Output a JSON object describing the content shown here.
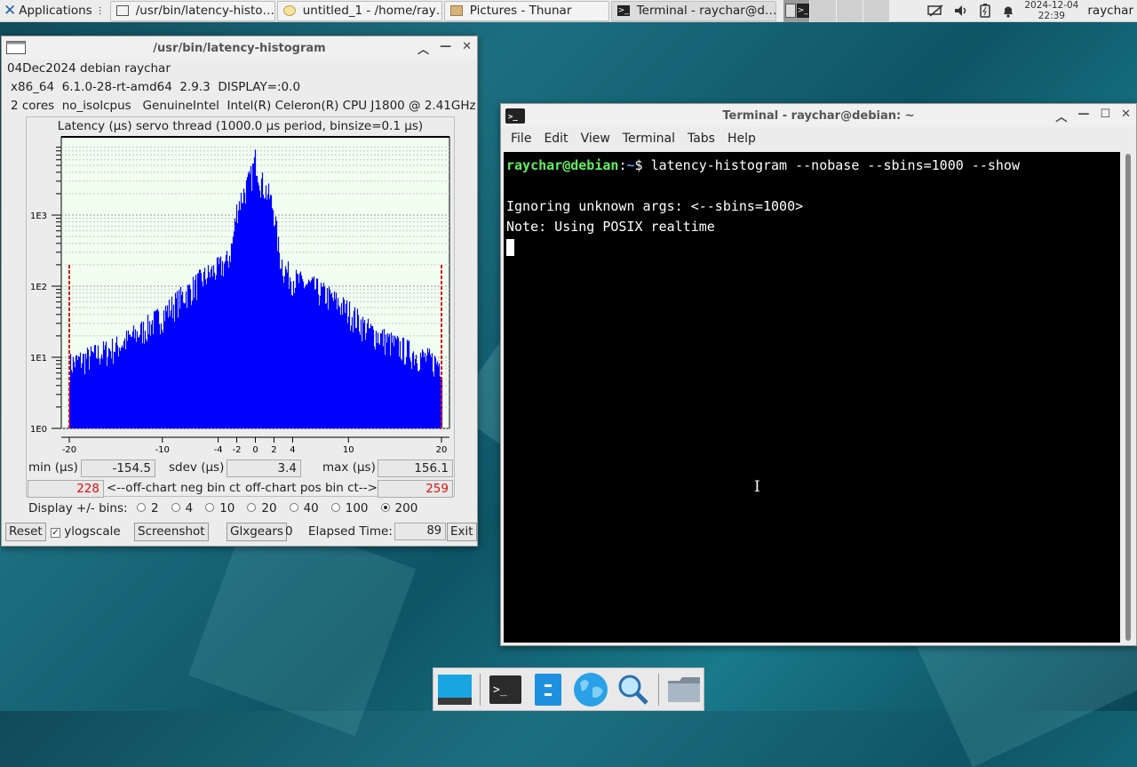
{
  "panel": {
    "applications_label": "Applications",
    "tasks": [
      {
        "label": "/usr/bin/latency-histo…",
        "icon": "window-icon"
      },
      {
        "label": "untitled_1 - /home/ray…",
        "icon": "text-editor-icon"
      },
      {
        "label": "Pictures - Thunar",
        "icon": "folder-icon"
      },
      {
        "label": "Terminal - raychar@d…",
        "icon": "terminal-icon"
      }
    ],
    "clock_date": "2024-12-04",
    "clock_time": "22:39",
    "user": "raychar"
  },
  "histogram_window": {
    "title": "/usr/bin/latency-histogram",
    "line1": "04Dec2024 debian raychar",
    "line2": "x86_64  6.1.0-28-rt-amd64  2.9.3  DISPLAY=:0.0",
    "line3": "2 cores  no_isolcpus   GenuineIntel  Intel(R) Celeron(R) CPU J1800 @ 2.41GHz",
    "min_label": "min (µs)",
    "min_value": "-154.5",
    "sdev_label": "sdev (µs)",
    "sdev_value": "3.4",
    "max_label": "max (µs)",
    "max_value": "156.1",
    "neg_ct_value": "228",
    "neg_ct_label": "<--off-chart neg bin ct",
    "pos_ct_label": "off-chart pos bin ct-->",
    "pos_ct_value": "259",
    "display_bins_label": "Display +/- bins:",
    "bin_options": [
      "2",
      "4",
      "10",
      "20",
      "40",
      "100",
      "200"
    ],
    "selected_bin": "200",
    "reset_label": "Reset",
    "ylogscale_label": "ylogscale",
    "ylogscale_checked": true,
    "screenshot_label": "Screenshot",
    "glxgears_label": "Glxgears",
    "glxgears_value": "0",
    "elapsed_label": "Elapsed Time:",
    "elapsed_value": "89",
    "exit_label": "Exit"
  },
  "chart_data": {
    "type": "bar",
    "title": "Latency (µs) servo thread (1000.0 µs period, binsize=0.1 µs)",
    "xlabel": "",
    "ylabel": "",
    "y_scale": "log",
    "ylim": [
      1,
      10000
    ],
    "xlim": [
      -20,
      20
    ],
    "y_tick_labels": [
      "1E0",
      "1E1",
      "1E2",
      "1E3"
    ],
    "x_tick_labels": [
      "-20",
      "-10",
      "-4",
      "-2",
      "0",
      "2",
      "4",
      "10",
      "20"
    ],
    "x_ticks": [
      -20,
      -10,
      -4,
      -2,
      0,
      2,
      4,
      10,
      20
    ],
    "bar_color": "#0000ff",
    "edge_marker_color": "#e01010",
    "edge_markers": [
      -20,
      20
    ],
    "profile_x": [
      -20,
      -18,
      -15,
      -12,
      -10,
      -8,
      -6,
      -5,
      -4,
      -3,
      -2.5,
      -2,
      -1.5,
      -1,
      -0.5,
      0,
      0.5,
      1,
      1.5,
      2,
      2.5,
      3,
      4,
      5,
      6,
      8,
      10,
      12,
      15,
      18,
      20
    ],
    "profile_y": [
      8,
      10,
      14,
      25,
      40,
      70,
      120,
      150,
      180,
      230,
      400,
      1300,
      1800,
      2500,
      3500,
      6500,
      3200,
      2400,
      1800,
      1100,
      300,
      180,
      130,
      110,
      100,
      70,
      45,
      25,
      15,
      10,
      8
    ]
  },
  "terminal_window": {
    "title": "Terminal - raychar@debian: ~",
    "menu": [
      "File",
      "Edit",
      "View",
      "Terminal",
      "Tabs",
      "Help"
    ],
    "prompt_user": "raychar@debian",
    "prompt_sep": ":",
    "prompt_path": "~",
    "prompt_dollar": "$",
    "command": "latency-histogram --nobase --sbins=1000 --show",
    "output_line1": "Ignoring unknown args: <--sbins=1000>",
    "output_line2": "Note: Using POSIX realtime"
  },
  "dock": {
    "items": [
      "show-desktop-icon",
      "terminal-icon",
      "file-manager-icon",
      "web-browser-icon",
      "app-finder-icon",
      "folder-icon"
    ]
  }
}
